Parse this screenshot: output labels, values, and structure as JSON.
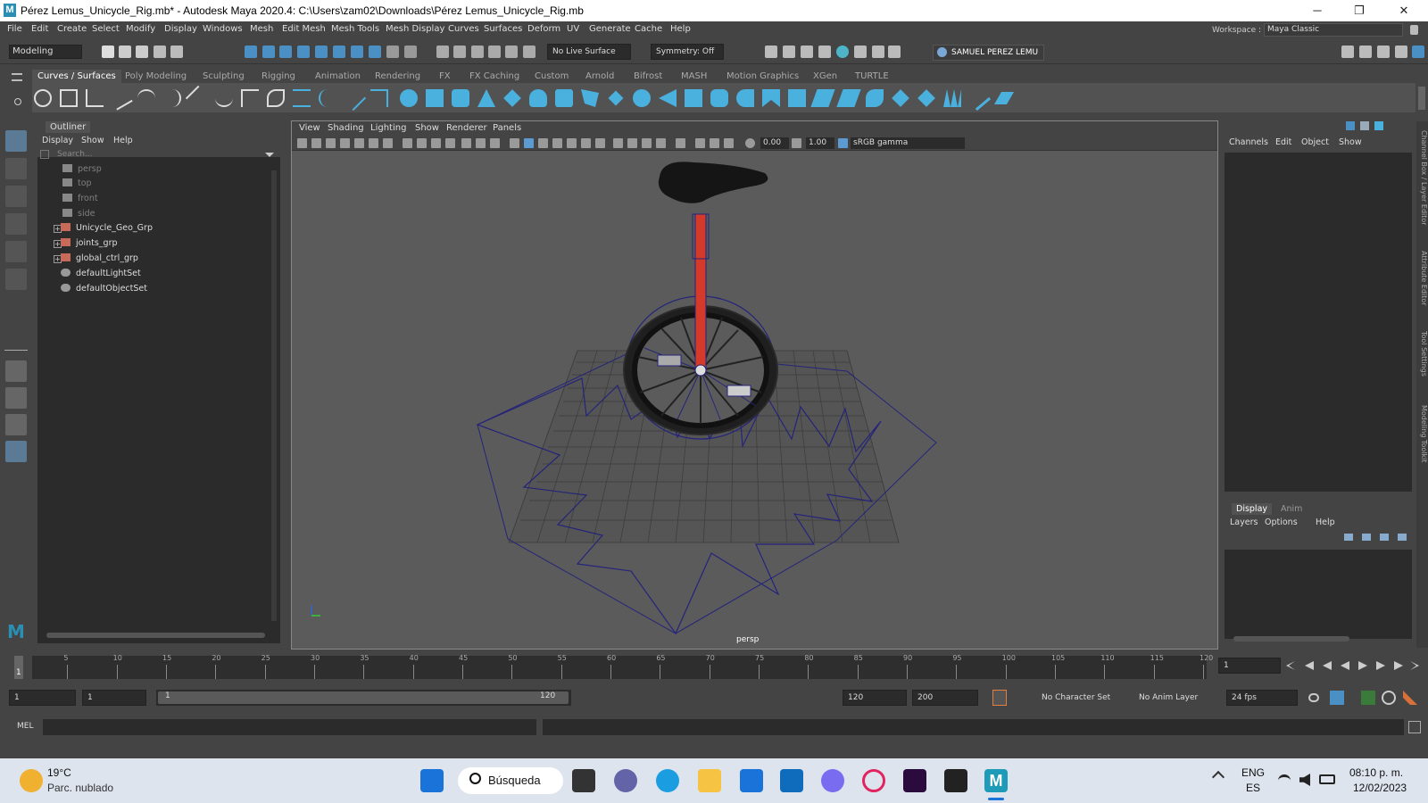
{
  "window": {
    "title": "Pérez Lemus_Unicycle_Rig.mb* - Autodesk Maya 2020.4: C:\\Users\\zam02\\Downloads\\Pérez Lemus_Unicycle_Rig.mb",
    "logo": "M",
    "minimize": "─",
    "maximize": "❐",
    "close": "✕"
  },
  "menubar": [
    "File",
    "Edit",
    "Create",
    "Select",
    "Modify",
    "Display",
    "Windows",
    "Mesh",
    "Edit Mesh",
    "Mesh Tools",
    "Mesh Display",
    "Curves",
    "Surfaces",
    "Deform",
    "UV",
    "Generate",
    "Cache",
    "Help"
  ],
  "workspace": {
    "label": "Workspace :",
    "value": "Maya Classic"
  },
  "statusline": {
    "mode": "Modeling",
    "live_surface": "No Live Surface",
    "symmetry": "Symmetry: Off",
    "user": "SAMUEL PEREZ LEMU"
  },
  "shelf_tabs": [
    "Curves / Surfaces",
    "Poly Modeling",
    "Sculpting",
    "Rigging",
    "Animation",
    "Rendering",
    "FX",
    "FX Caching",
    "Custom",
    "Arnold",
    "Bifrost",
    "MASH",
    "Motion Graphics",
    "XGen",
    "TURTLE"
  ],
  "outliner": {
    "title": "Outliner",
    "menu": [
      "Display",
      "Show",
      "Help"
    ],
    "search_placeholder": "Search...",
    "cameras": [
      "persp",
      "top",
      "front",
      "side"
    ],
    "groups": [
      "Unicycle_Geo_Grp",
      "joints_grp",
      "global_ctrl_grp"
    ],
    "sets": [
      "defaultLightSet",
      "defaultObjectSet"
    ]
  },
  "viewport": {
    "menu": [
      "View",
      "Shading",
      "Lighting",
      "Show",
      "Renderer",
      "Panels"
    ],
    "exposure": "0.00",
    "gamma": "1.00",
    "color_space": "sRGB gamma",
    "camera_label": "persp"
  },
  "channelbox": {
    "menu": [
      "Channels",
      "Edit",
      "Object",
      "Show"
    ],
    "layer_tabs": [
      "Display",
      "Anim"
    ],
    "layer_menu": [
      "Layers",
      "Options",
      "Help"
    ]
  },
  "side_tabs": [
    "Channel Box / Layer Editor",
    "Attribute Editor",
    "Tool Settings",
    "Modeling Toolkit"
  ],
  "timeline": {
    "ticks": [
      "5",
      "10",
      "15",
      "20",
      "25",
      "30",
      "35",
      "40",
      "45",
      "50",
      "55",
      "60",
      "65",
      "70",
      "75",
      "80",
      "85",
      "90",
      "95",
      "100",
      "105",
      "110",
      "115",
      "120"
    ],
    "current_frame": "1",
    "frame_field": "1"
  },
  "range": {
    "start": "1",
    "playback_start": "1",
    "slider_start": "1",
    "slider_end": "120",
    "playback_end": "120",
    "end": "200",
    "character_set": "No Character Set",
    "anim_layer": "No Anim Layer",
    "fps": "24 fps"
  },
  "cmdline": {
    "lang": "MEL"
  },
  "taskbar": {
    "weather_temp": "19°C",
    "weather_desc": "Parc. nublado",
    "search": "Búsqueda",
    "lang1": "ENG",
    "lang2": "ES",
    "time": "08:10 p. m.",
    "date": "12/02/2023"
  },
  "colors": {
    "accent": "#5285a6",
    "wire": "#24247a",
    "frame_red": "#d43a2a"
  }
}
